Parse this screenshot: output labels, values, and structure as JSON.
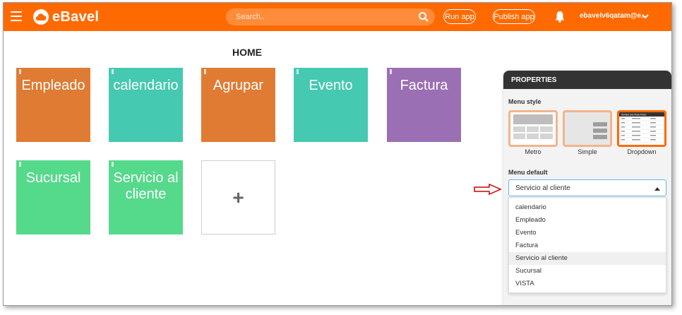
{
  "header": {
    "brand": "eBavel",
    "search_placeholder": "Search..",
    "run_label": "Run app",
    "publish_label": "Publish app",
    "user": "ebavelv6qatam@e..."
  },
  "main": {
    "title": "HOME",
    "tiles": [
      {
        "label": "Empleado",
        "color": "#e07b33"
      },
      {
        "label": "calendario",
        "color": "#45c9b1"
      },
      {
        "label": "Agrupar",
        "color": "#e07b33"
      },
      {
        "label": "Evento",
        "color": "#45c9b1"
      },
      {
        "label": "Factura",
        "color": "#9b6fb3"
      },
      {
        "label": "Sucursal",
        "color": "#55d98b"
      },
      {
        "label": "Servicio al cliente",
        "color": "#55d98b"
      }
    ],
    "add_symbol": "+"
  },
  "properties": {
    "title": "PROPERTIES",
    "menu_style_label": "Menu style",
    "styles": [
      "Metro",
      "Simple",
      "Dropdown"
    ],
    "selected_style": "Dropdown",
    "menu_default_label": "Menu default",
    "menu_default_value": "Servicio al cliente",
    "options": [
      "calendario",
      "Empleado",
      "Evento",
      "Factura",
      "Servicio al cliente",
      "Sucursal",
      "VISTA"
    ],
    "highlighted_option": "Servicio al cliente",
    "dropdown_thumb_header": "Nombre dos   Plano   Plano"
  },
  "colors": {
    "brand": "#ff6a00",
    "panel_header": "#333333",
    "arrow": "#cc0000"
  }
}
